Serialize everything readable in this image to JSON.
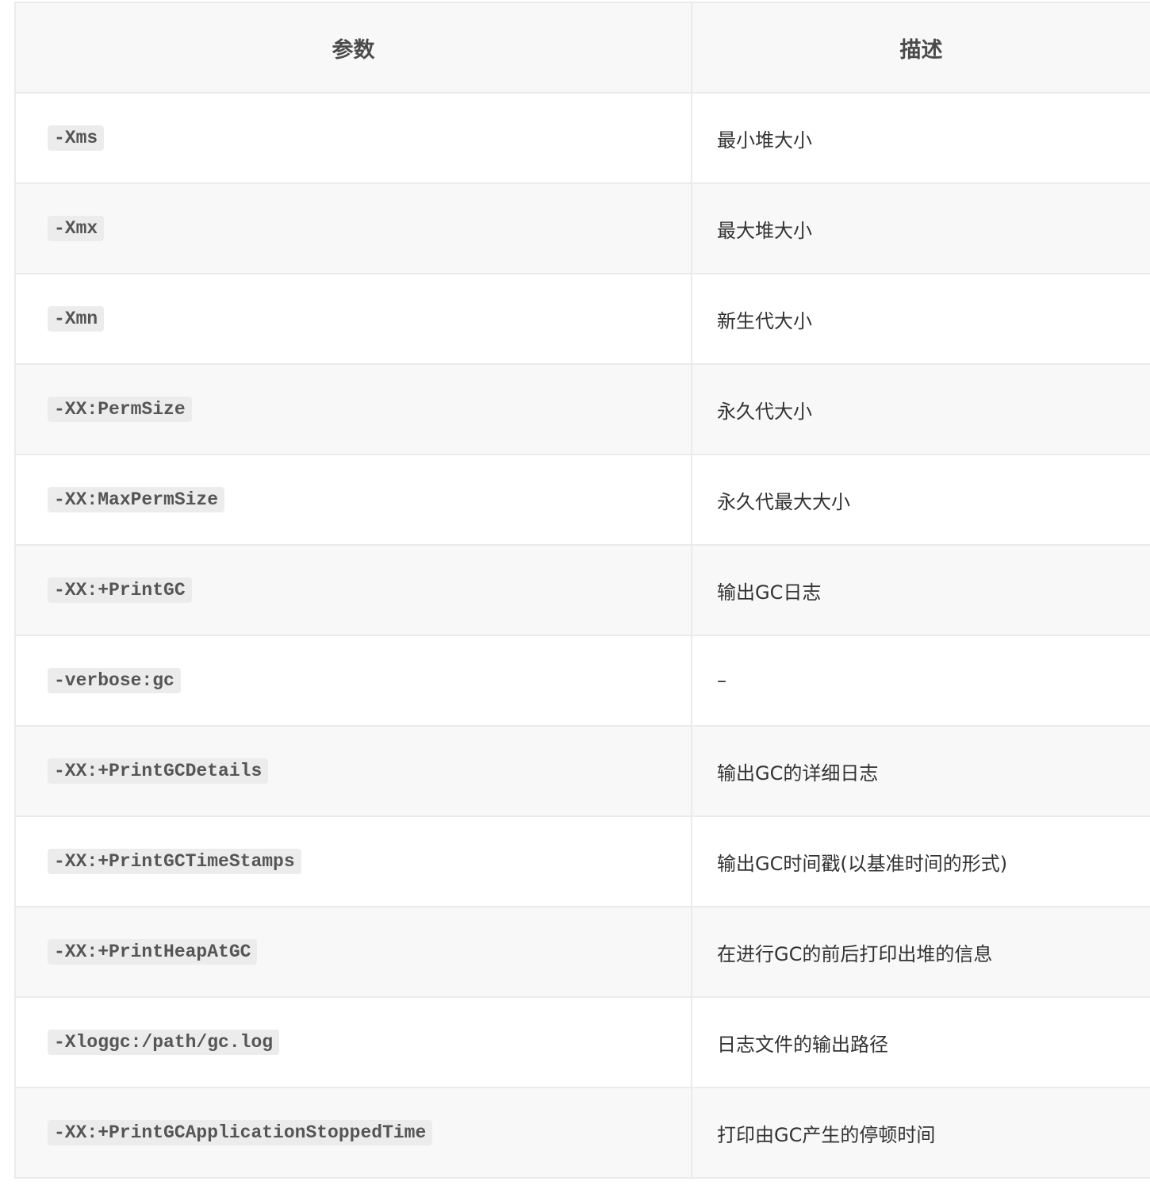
{
  "table": {
    "headers": [
      "参数",
      "描述"
    ],
    "rows": [
      {
        "param": "-Xms",
        "desc": "最小堆大小"
      },
      {
        "param": "-Xmx",
        "desc": "最大堆大小"
      },
      {
        "param": "-Xmn",
        "desc": "新生代大小"
      },
      {
        "param": "-XX:PermSize",
        "desc": "永久代大小"
      },
      {
        "param": "-XX:MaxPermSize",
        "desc": "永久代最大大小"
      },
      {
        "param": "-XX:+PrintGC",
        "desc": "输出GC日志"
      },
      {
        "param": "-verbose:gc",
        "desc": "–"
      },
      {
        "param": "-XX:+PrintGCDetails",
        "desc": "输出GC的详细日志"
      },
      {
        "param": "-XX:+PrintGCTimeStamps",
        "desc": "输出GC时间戳(以基准时间的形式)"
      },
      {
        "param": "-XX:+PrintHeapAtGC",
        "desc": "在进行GC的前后打印出堆的信息"
      },
      {
        "param": "-Xloggc:/path/gc.log",
        "desc": "日志文件的输出路径"
      },
      {
        "param": "-XX:+PrintGCApplicationStoppedTime",
        "desc": "打印由GC产生的停顿时间"
      }
    ]
  }
}
